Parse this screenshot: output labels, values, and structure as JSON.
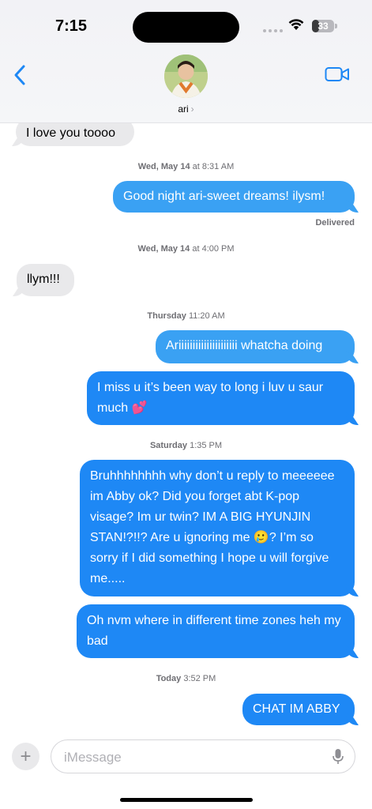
{
  "status": {
    "time": "7:15",
    "battery": "33",
    "battery_level": 0.33
  },
  "header": {
    "contact_name": "ari",
    "chevron": "›"
  },
  "messages": [
    {
      "text": "I love you toooo",
      "direction": "incoming"
    },
    {
      "text": "Good night ari-sweet dreams! ilysm!",
      "direction": "outgoing"
    },
    {
      "text": "llym!!!",
      "direction": "incoming"
    },
    {
      "text": "Ariiiiiiiiiiiiiiiiiiiii whatcha doing",
      "direction": "outgoing"
    },
    {
      "text": "I miss u it’s been way to long i luv u saur much 💕",
      "direction": "outgoing"
    },
    {
      "text": "Bruhhhhhhhh why don’t u reply to meeeeee im Abby ok? Did you forget abt K-pop visage? Im ur twin? IM A BIG HYUNJIN STAN!?!!? Are u ignoring me 🥲? I’m so sorry if I did something I hope u will forgive me.....",
      "direction": "outgoing"
    },
    {
      "text": "Oh nvm where in different time zones heh my bad",
      "direction": "outgoing"
    },
    {
      "text": "CHAT IM ABBY",
      "direction": "outgoing"
    }
  ],
  "timestamps": [
    {
      "day": "Wed, May 14",
      "time": "at 8:31 AM"
    },
    {
      "day": "Wed, May 14",
      "time": "at 4:00 PM"
    },
    {
      "day": "Thursday",
      "time": "11:20 AM"
    },
    {
      "day": "Saturday",
      "time": "1:35 PM"
    },
    {
      "day": "Today",
      "time": "3:52 PM"
    }
  ],
  "delivered": "Delivered",
  "composer": {
    "placeholder": "iMessage",
    "value": "",
    "plus": "+"
  },
  "icons": [
    "back-chevron-icon",
    "video-call-icon",
    "plus-icon",
    "microphone-icon",
    "wifi-icon",
    "battery-icon"
  ],
  "colors": {
    "outgoing": "#1e88f5",
    "incoming": "#e9e9eb",
    "accent": "#1e88f5"
  }
}
